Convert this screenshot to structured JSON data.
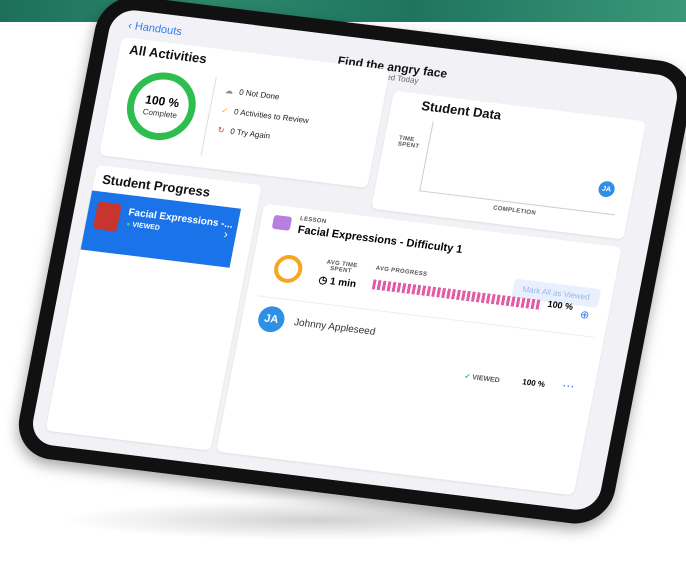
{
  "nav": {
    "back_label": "Handouts"
  },
  "assignment": {
    "title": "Find the angry face",
    "subtitle": "Assigned Today"
  },
  "all_activities": {
    "heading": "All Activities",
    "percent": "100 %",
    "percent_caption": "Complete",
    "not_done": "0 Not Done",
    "to_review": "0 Activities to Review",
    "try_again": "0 Try Again"
  },
  "student_data": {
    "heading": "Student Data",
    "time_spent_label": "TIME SPENT",
    "completion_label": "COMPLETION",
    "avatar_initials": "JA"
  },
  "student_progress": {
    "heading": "Student Progress",
    "item_title": "Facial Expressions -...",
    "item_status": "VIEWED"
  },
  "lesson": {
    "label": "LESSON",
    "title": "Facial Expressions - Difficulty 1",
    "mark_all": "Mark All as Viewed",
    "avg_time_label": "AVG TIME SPENT",
    "avg_time_value": "1 min",
    "avg_progress_label": "AVG PROGRESS",
    "avg_progress_value": "100 %",
    "avg_progress_fraction": 1.0
  },
  "student": {
    "initials": "JA",
    "name": "Johnny Appleseed",
    "status": "VIEWED",
    "percent": "100 %"
  }
}
